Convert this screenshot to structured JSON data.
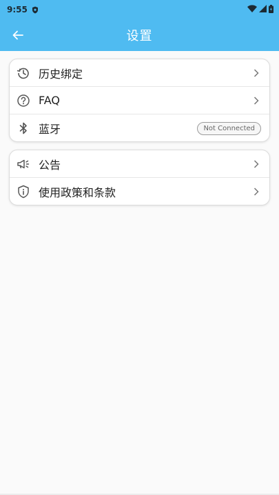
{
  "status_bar": {
    "time": "9:55"
  },
  "app_bar": {
    "title": "设置"
  },
  "group1": {
    "items": [
      {
        "label": "历史绑定",
        "icon": "history-icon"
      },
      {
        "label": "FAQ",
        "icon": "help-circle-icon"
      },
      {
        "label": "蓝牙",
        "icon": "bluetooth-icon",
        "badge": "Not Connected"
      }
    ]
  },
  "group2": {
    "items": [
      {
        "label": "公告",
        "icon": "megaphone-icon"
      },
      {
        "label": "使用政策和条款",
        "icon": "shield-info-icon"
      }
    ]
  },
  "colors": {
    "accent": "#4fbbf1",
    "card_border": "#dcdcdc"
  }
}
